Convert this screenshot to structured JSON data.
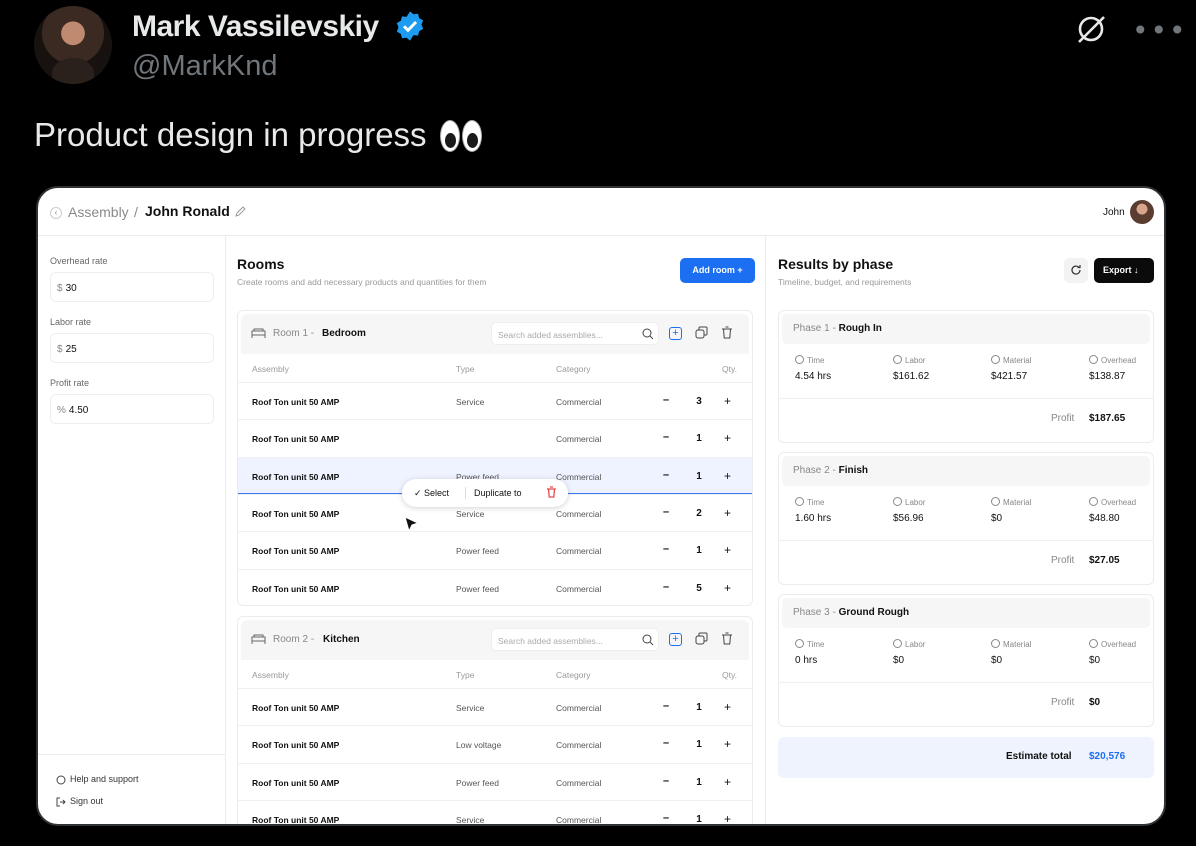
{
  "tweet": {
    "author_name": "Mark Vassilevskiy",
    "handle": "@MarkKnd",
    "text": "Product design in progress",
    "more": "•••"
  },
  "app": {
    "breadcrumb": {
      "root": "Assembly",
      "sep": "/",
      "current": "John Ronald"
    },
    "user": "John",
    "accent_color": "#1d6ff2",
    "rates": [
      {
        "label": "Overhead rate",
        "unit": "$",
        "value": "30"
      },
      {
        "label": "Labor rate",
        "unit": "$",
        "value": "25"
      },
      {
        "label": "Profit rate",
        "unit": "%",
        "value": "4.50"
      }
    ],
    "footer": {
      "help": "Help and support",
      "signout": "Sign out"
    },
    "rooms_section": {
      "title": "Rooms",
      "subtitle": "Create rooms and add necessary products and quantities for them",
      "add_label": "Add room +"
    },
    "columns": {
      "assembly": "Assembly",
      "type": "Type",
      "category": "Category",
      "qty": "Qty."
    },
    "rooms": [
      {
        "num": "Room 1 - ",
        "name": "Bedroom",
        "search_placeholder": "Search added assemblies...",
        "rows": [
          {
            "assembly": "Roof Ton unit 50 AMP",
            "type": "Service",
            "category": "Commercial",
            "qty": "3"
          },
          {
            "assembly": "Roof Ton unit 50 AMP",
            "type": "",
            "category": "Commercial",
            "qty": "1"
          },
          {
            "assembly": "Roof Ton unit 50 AMP",
            "type": "Power feed",
            "category": "Commercial",
            "qty": "1"
          },
          {
            "assembly": "Roof Ton unit 50 AMP",
            "type": "Service",
            "category": "Commercial",
            "qty": "2"
          },
          {
            "assembly": "Roof Ton unit 50 AMP",
            "type": "Power feed",
            "category": "Commercial",
            "qty": "1"
          },
          {
            "assembly": "Roof Ton unit 50 AMP",
            "type": "Power feed",
            "category": "Commercial",
            "qty": "5"
          }
        ]
      },
      {
        "num": "Room 2 - ",
        "name": "Kitchen",
        "search_placeholder": "Search added assemblies...",
        "rows": [
          {
            "assembly": "Roof Ton unit 50 AMP",
            "type": "Service",
            "category": "Commercial",
            "qty": "1"
          },
          {
            "assembly": "Roof Ton unit 50 AMP",
            "type": "Low voltage",
            "category": "Commercial",
            "qty": "1"
          },
          {
            "assembly": "Roof Ton unit 50 AMP",
            "type": "Power feed",
            "category": "Commercial",
            "qty": "1"
          },
          {
            "assembly": "Roof Ton unit 50 AMP",
            "type": "Service",
            "category": "Commercial",
            "qty": "1"
          }
        ]
      }
    ],
    "context_menu": {
      "select": "✓ Select",
      "duplicate": "Duplicate to"
    },
    "results": {
      "title": "Results by phase",
      "subtitle": "Timeline, budget, and requirements",
      "export_label": "Export ↓",
      "metric_labels": {
        "time": "Time",
        "labor": "Labor",
        "material": "Material",
        "overhead": "Overhead",
        "profit": "Profit"
      },
      "phases": [
        {
          "num": "Phase 1 - ",
          "name": "Rough In",
          "time": "4.54 hrs",
          "labor": "$161.62",
          "material": "$421.57",
          "overhead": "$138.87",
          "profit": "$187.65"
        },
        {
          "num": "Phase 2 - ",
          "name": "Finish",
          "time": "1.60 hrs",
          "labor": "$56.96",
          "material": "$0",
          "overhead": "$48.80",
          "profit": "$27.05"
        },
        {
          "num": "Phase 3 - ",
          "name": "Ground Rough",
          "time": "0 hrs",
          "labor": "$0",
          "material": "$0",
          "overhead": "$0",
          "profit": "$0"
        }
      ],
      "estimate_label": "Estimate total",
      "estimate_value": "$20,576"
    }
  }
}
